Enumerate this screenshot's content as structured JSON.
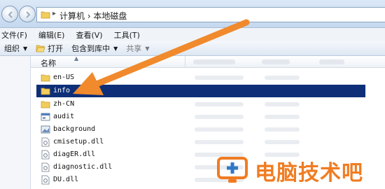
{
  "address_bar": {
    "path": "计算机 › 本地磁盘",
    "colors": {
      "bg": "#cddcee"
    }
  },
  "menu": {
    "items": [
      "文件(F)",
      "编辑(E)",
      "查看(V)",
      "工具(T)"
    ]
  },
  "toolbar": {
    "organize": "组织",
    "open": "打开",
    "include": "包含到库中",
    "share": "共享"
  },
  "columns": {
    "name": "名称"
  },
  "files": [
    {
      "name": "en-US",
      "icon": "folder-icon",
      "selected": false
    },
    {
      "name": "info",
      "icon": "folder-icon",
      "selected": true
    },
    {
      "name": "zh-CN",
      "icon": "folder-icon",
      "selected": false
    },
    {
      "name": "audit",
      "icon": "app-icon",
      "selected": false
    },
    {
      "name": "background",
      "icon": "image-file-icon",
      "selected": false
    },
    {
      "name": "cmisetup.dll",
      "icon": "dll-file-icon",
      "selected": false
    },
    {
      "name": "diagER.dll",
      "icon": "dll-file-icon",
      "selected": false
    },
    {
      "name": "diagnostic.dll",
      "icon": "dll-file-icon",
      "selected": false
    },
    {
      "name": "DU.dll",
      "icon": "dll-file-icon",
      "selected": false
    }
  ],
  "watermark": {
    "text": "电脑技术吧",
    "color": "#f07c22"
  },
  "colors": {
    "selection": "#0e2f78",
    "arrow": "#f08a2c"
  }
}
